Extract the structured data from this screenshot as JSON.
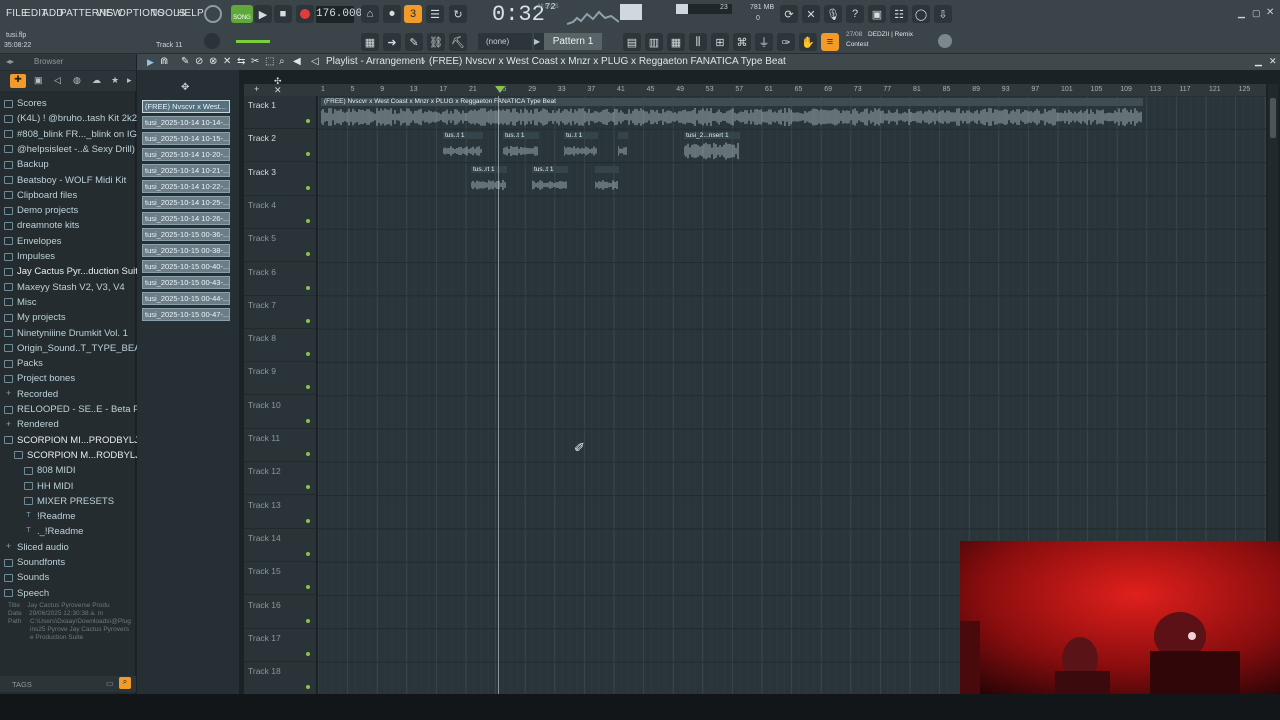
{
  "menu": [
    "FILE",
    "EDIT",
    "ADD",
    "PATTERNS",
    "VIEW",
    "OPTIONS",
    "TOOLS",
    "HELP"
  ],
  "transport": {
    "song_mode": "SONG",
    "tempo": "176.000",
    "time": "0:32",
    "time_sub": "72",
    "time_label": "M:S:CS",
    "cpu_number": "23",
    "memory": "781 MB",
    "memory_sub": "0"
  },
  "project": {
    "file": "tusi.flp",
    "elapsed": "35:08:22",
    "hint": "Track 11"
  },
  "pattern_selector": {
    "snap": "(none)",
    "pattern": "Pattern 1"
  },
  "news": {
    "date": "27/08",
    "title": "DEDZII | Remix",
    "subtitle": "Contest"
  },
  "playlist": {
    "title": "Playlist - Arrangement",
    "breadcrumb": "(FREE) Nvscvr x  West Coast  x Mnzr x PLUG  x Reggaeton FANATICA Type Beat"
  },
  "browser": {
    "header": "Browser",
    "items": [
      {
        "label": "Scores",
        "icon": "folder-icon"
      },
      {
        "label": "(K4L) ! @bruho..tash Kit 2k24",
        "icon": "folder-icon"
      },
      {
        "label": "#808_blink FR..._blink on IG)",
        "icon": "folder-icon"
      },
      {
        "label": "@helpsisleet -..& Sexy Drill)",
        "icon": "folder-icon"
      },
      {
        "label": "Backup",
        "icon": "folder-icon"
      },
      {
        "label": "Beatsboy - WOLF Midi Kit",
        "icon": "folder-icon"
      },
      {
        "label": "Clipboard files",
        "icon": "folder-icon"
      },
      {
        "label": "Demo projects",
        "icon": "folder-icon"
      },
      {
        "label": "dreamnote kits",
        "icon": "folder-icon"
      },
      {
        "label": "Envelopes",
        "icon": "folder-icon"
      },
      {
        "label": "Impulses",
        "icon": "folder-icon"
      },
      {
        "label": "Jay Cactus Pyr...duction Suite",
        "icon": "folder-icon"
      },
      {
        "label": "Maxeyy Stash V2, V3, V4",
        "icon": "folder-icon"
      },
      {
        "label": "Misc",
        "icon": "folder-icon"
      },
      {
        "label": "My projects",
        "icon": "folder-icon"
      },
      {
        "label": "Ninetyniiine Drumkit Vol. 1",
        "icon": "folder-icon"
      },
      {
        "label": "Origin_Sound..T_TYPE_BEATS",
        "icon": "folder-icon"
      },
      {
        "label": "Packs",
        "icon": "folder-icon"
      },
      {
        "label": "Project bones",
        "icon": "folder-icon"
      },
      {
        "label": "Recorded",
        "icon": "plus-icon"
      },
      {
        "label": "RELOOPED - SE..E - Beta Pack",
        "icon": "folder-icon"
      },
      {
        "label": "Rendered",
        "icon": "plus-icon"
      },
      {
        "label": "SCORPION MI...PRODBYLJS",
        "icon": "folder-icon"
      },
      {
        "label": "SCORPION M...RODBYLJS",
        "icon": "folder-icon"
      },
      {
        "label": "808 MIDI",
        "icon": "folder-icon"
      },
      {
        "label": "HH MIDI",
        "icon": "folder-icon"
      },
      {
        "label": "MIXER PRESETS",
        "icon": "folder-icon"
      },
      {
        "label": "!Readme",
        "icon": "text-icon"
      },
      {
        "label": "._!Readme",
        "icon": "text-icon"
      },
      {
        "label": "Sliced audio",
        "icon": "plus-icon"
      },
      {
        "label": "Soundfonts",
        "icon": "folder-icon"
      },
      {
        "label": "Sounds",
        "icon": "folder-icon"
      },
      {
        "label": "Speech",
        "icon": "folder-icon"
      }
    ],
    "info": {
      "title_label": "Title",
      "title_value": "Jay Cactus Pyroverse Produ",
      "date_label": "Date",
      "date_value": "29/06/2025 12:30:38 a. m",
      "path_label": "Path",
      "path_value": "C:\\Users\\Dxaay\\Downloads\\@Plugins25 Pyrove Jay Cactus Pyroverse Production Suite"
    },
    "tags_label": "TAGS"
  },
  "patterns": [
    "(FREE) Nvscvr x  West...",
    "tusi_2025-10-14 10-14-...",
    "tusi_2025-10-14 10-15-...",
    "tusi_2025-10-14 10-20-...",
    "tusi_2025-10-14 10-21-...",
    "tusi_2025-10-14 10-22-...",
    "tusi_2025-10-14 10-25-...",
    "tusi_2025-10-14 10-26-...",
    "tusi_2025-10-15 00-36-...",
    "tusi_2025-10-15 00-38-...",
    "tusi_2025-10-15 00-40-...",
    "tusi_2025-10-15 00-43-...",
    "tusi_2025-10-15 00-44-...",
    "tusi_2025-10-15 00-47-..."
  ],
  "tracks": [
    "Track 1",
    "Track 2",
    "Track 3",
    "Track 4",
    "Track 5",
    "Track 6",
    "Track 7",
    "Track 8",
    "Track 9",
    "Track 10",
    "Track 11",
    "Track 12",
    "Track 13",
    "Track 14",
    "Track 15",
    "Track 16",
    "Track 17",
    "Track 18"
  ],
  "ruler": [
    "1",
    "5",
    "9",
    "13",
    "17",
    "21",
    "25",
    "29",
    "33",
    "37",
    "41",
    "45",
    "49",
    "53",
    "57",
    "61",
    "65",
    "69",
    "73",
    "77",
    "81",
    "85",
    "89",
    "93",
    "97",
    "101",
    "105",
    "109",
    "113",
    "117",
    "121",
    "125"
  ],
  "clips": {
    "main": "(FREE) Nvscvr x  West Coast  x Mnzr x PLUG  x Reggaeton FANATICA Type Beat",
    "t2": [
      "tus..t 1",
      "tus..t 1",
      "tu..t 1",
      "",
      "tusi_2...nsert 1"
    ],
    "t3": [
      "tus..rt 1",
      "tus..t 1",
      ""
    ]
  },
  "colors": {
    "accent": "#f39b2a",
    "waveform": "#9fb0b7",
    "grid": "#2a3539",
    "led": "#8bc34a"
  }
}
